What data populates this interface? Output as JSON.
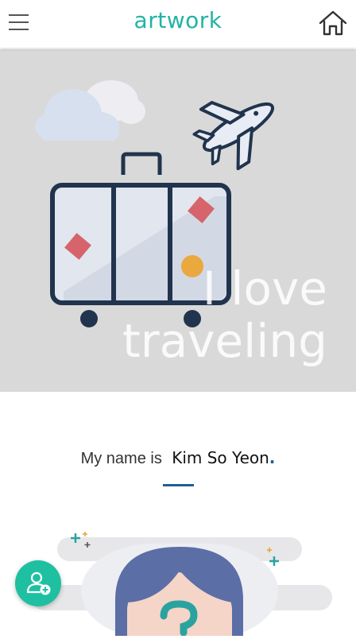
{
  "header": {
    "logo_text": "artwork",
    "brand_color": "#22b3a6",
    "menu_icon": "hamburger-menu-icon",
    "home_icon": "home-icon"
  },
  "hero": {
    "headline_line1": "I love",
    "headline_line2": "traveling",
    "background_color": "#d9d9d9"
  },
  "profile": {
    "name_prefix": "My name is",
    "name_value": "Kim So Yeon",
    "name_suffix": ".",
    "accent_color": "#1f5f96"
  },
  "fab": {
    "icon": "add-user-icon",
    "color": "#1ec0a1"
  }
}
